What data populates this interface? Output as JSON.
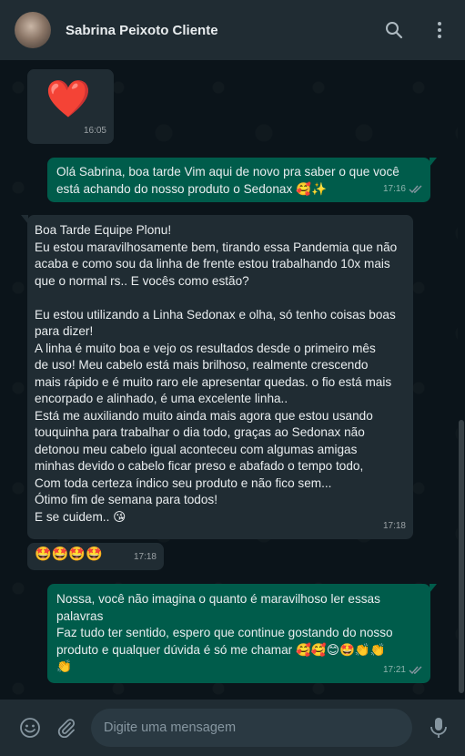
{
  "header": {
    "contact_name": "Sabrina Peixoto Cliente",
    "icons": [
      "search-icon",
      "menu-icon"
    ]
  },
  "messages": [
    {
      "direction": "in",
      "text": "❤️",
      "time": "16:05"
    },
    {
      "direction": "out",
      "text": "Olá Sabrina, boa tarde Vim aqui de novo pra saber o que você\nestá achando do nosso produto o Sedonax 🥰✨",
      "time": "17:16"
    },
    {
      "direction": "in",
      "text": "Boa Tarde Equipe Plonu!\nEu estou maravilhosamente bem, tirando essa Pandemia que não\nacaba e como sou da linha de frente estou trabalhando 10x mais\nque o normal rs.. E vocês como estão?\n\nEu estou utilizando a Linha Sedonax e olha, só tenho coisas boas\npara dizer!\nA linha é muito boa e vejo os resultados desde o primeiro mês\nde uso! Meu cabelo está mais brilhoso, realmente crescendo\nmais rápido e é muito raro ele apresentar quedas. o fio está mais\nencorpado e alinhado, é uma excelente linha..\nEstá me auxiliando muito ainda mais agora que estou usando\ntouquinha para trabalhar o dia todo, graças ao Sedonax não\ndetonou meu cabelo igual aconteceu com algumas amigas\nminhas devido o cabelo ficar preso e abafado o tempo todo,\nCom toda certeza índico seu produto e não fico sem...\nÓtimo fim de semana para todos!\nE se cuidem.. 😘",
      "time": "17:18"
    },
    {
      "direction": "in",
      "text": "🤩🤩🤩🤩",
      "time": "17:18"
    },
    {
      "direction": "out",
      "text": "Nossa, você não imagina o quanto é maravilhoso ler essas\npalavras\nFaz tudo ter sentido, espero que continue gostando do nosso\nproduto e qualquer dúvida é só me chamar 🥰🥰😊🤩👏👏\n👏",
      "time": "17:21"
    }
  ],
  "footer": {
    "input_placeholder": "Digite uma mensagem",
    "icons": [
      "emoji-icon",
      "attach-icon",
      "microphone-icon"
    ]
  },
  "colors": {
    "header_bg": "#202c33",
    "chat_bg": "#0b141a",
    "incoming_bubble": "#202c33",
    "outgoing_bubble": "#005c4b",
    "read_ticks": "#8696a0"
  }
}
